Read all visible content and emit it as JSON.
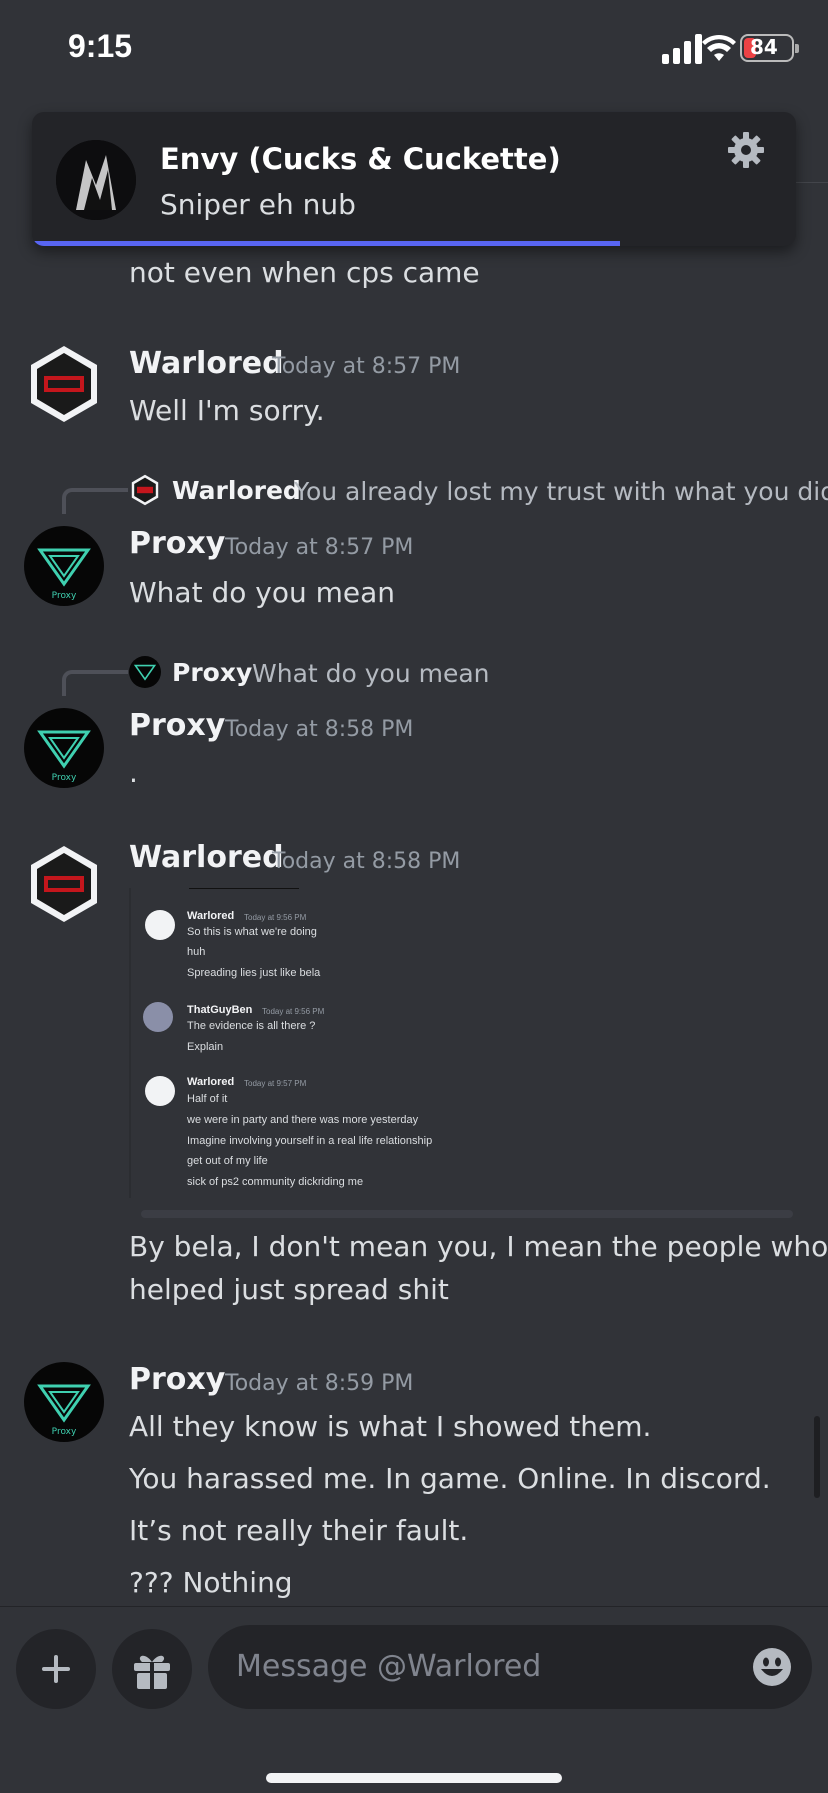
{
  "status_bar": {
    "time": "9:15",
    "battery": "84"
  },
  "notification": {
    "title": "Envy (Cucks & Cuckette)",
    "body": "Sniper eh nub",
    "progress": 0.77
  },
  "messages": {
    "m0": {
      "text": "not even when cps came"
    },
    "m1": {
      "author": "Warlored",
      "time": "Today at 8:57 PM",
      "lines": [
        "Well I'm sorry."
      ]
    },
    "m2": {
      "reply_author": "Warlored",
      "reply_text": "You already lost my trust with what you did",
      "author": "Proxy",
      "time": "Today at 8:57 PM",
      "lines": [
        "What do you mean"
      ]
    },
    "m3": {
      "reply_author": "Proxy",
      "reply_text": "What do you mean",
      "author": "Proxy",
      "time": "Today at 8:58 PM",
      "lines": [
        "."
      ]
    },
    "m4": {
      "author": "Warlored",
      "time": "Today at 8:58 PM",
      "lines": [
        "By bela, I don't mean you, I mean the people who",
        "helped just spread shit"
      ]
    },
    "m5": {
      "author": "Proxy",
      "time": "Today at 8:59 PM",
      "lines": [
        "All they know is what I showed them.",
        "You harassed me. In game. Online. In discord.",
        "It’s not really their fault.",
        "??? Nothing"
      ]
    }
  },
  "embedded_screenshot": {
    "g1": {
      "author": "Warlored",
      "time": "Today at 9:56 PM",
      "lines": [
        "So this is what we're doing",
        "huh",
        "Spreading lies just like bela"
      ]
    },
    "g2": {
      "author": "ThatGuyBen",
      "time": "Today at 9:56 PM",
      "lines": [
        "The evidence is all there ?",
        "Explain"
      ]
    },
    "g3": {
      "author": "Warlored",
      "time": "Today at 9:57 PM",
      "lines": [
        "Half of it",
        "we were in party and there was more yesterday",
        "Imagine involving yourself in a real life relationship",
        "get out of my life",
        "sick of ps2 community dickriding me"
      ]
    }
  },
  "composer": {
    "placeholder": "Message @Warlored"
  },
  "colors": {
    "background": "#313338",
    "accent": "#5865f2",
    "input": "#232428"
  },
  "icons": [
    "signal-icon",
    "wifi-icon",
    "battery-icon",
    "gear-icon",
    "plus-icon",
    "gift-icon",
    "emoji-icon"
  ]
}
